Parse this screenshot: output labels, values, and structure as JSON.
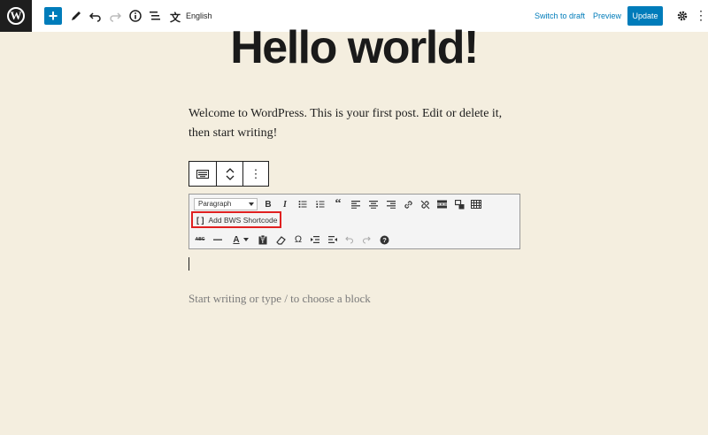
{
  "topbar": {
    "language": "English",
    "switch_to_draft": "Switch to draft",
    "preview": "Preview",
    "update": "Update"
  },
  "post": {
    "title": "Hello world!",
    "paragraph": "Welcome to WordPress. This is your first post. Edit or delete it, then start writing!",
    "placeholder": "Start writing or type / to choose a block"
  },
  "classic_editor": {
    "format_select": "Paragraph",
    "shortcode_button": "Add BWS Shortcode"
  },
  "colors": {
    "accent": "#007cba",
    "canvas": "#f4eedf",
    "highlight": "#e02020"
  }
}
